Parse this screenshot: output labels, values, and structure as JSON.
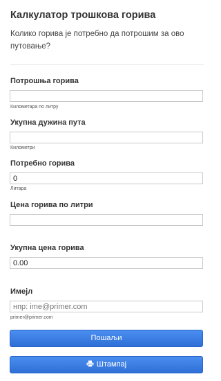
{
  "header": {
    "title": "Калкулатор трошкова горива",
    "subtitle": "Колико горива је потребно да потрошим за ово путовање?"
  },
  "fuel_consumption": {
    "label": "Потрошња горива",
    "value": "",
    "hint": "Километара по литру"
  },
  "total_distance": {
    "label": "Укупна дужина пута",
    "value": "",
    "hint": "Километри"
  },
  "fuel_needed": {
    "label": "Потребно горива",
    "value": "0",
    "hint": "Литара"
  },
  "fuel_price": {
    "label": "Цена горива по литри",
    "value": ""
  },
  "total_cost": {
    "label": "Укупна цена горива",
    "value": "0.00"
  },
  "email": {
    "label": "Имејл",
    "placeholder": "нпр: ime@primer.com",
    "hint": "primer@primer.com"
  },
  "buttons": {
    "send_label": "Пошаљи",
    "print_label": "Штампај",
    "print_icon": "printer-icon"
  },
  "colors": {
    "button_blue": "#2f6fd6",
    "button_border": "#2a64c8"
  }
}
